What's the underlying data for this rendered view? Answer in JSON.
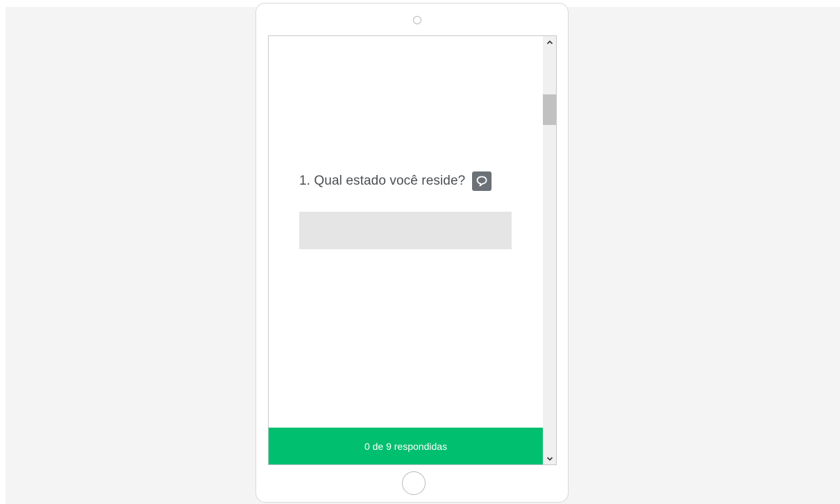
{
  "survey": {
    "question": "1. Qual estado você reside?",
    "answer_value": "",
    "progress_text": "0 de 9 respondidas",
    "progress_fraction": 0
  },
  "icons": {
    "comment": "speech-bubble-icon",
    "scroll_up": "chevron-up-icon",
    "scroll_down": "chevron-down-icon"
  },
  "colors": {
    "progress_green": "#00bf6f",
    "page_background": "#f3f4f3",
    "question_text": "#4a4f54",
    "comment_button": "#6b7176"
  }
}
